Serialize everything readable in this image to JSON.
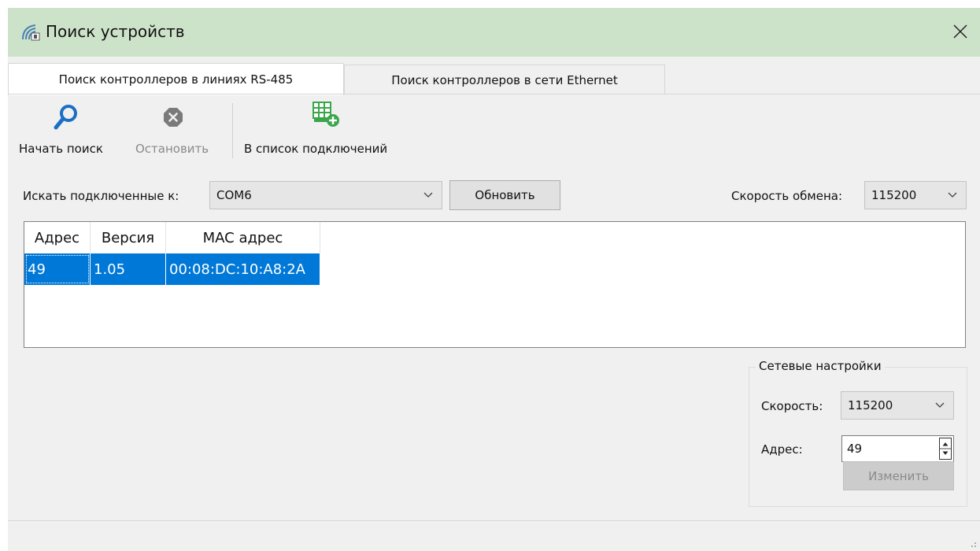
{
  "window": {
    "title": "Поиск устройств",
    "title_icon": "antenna-icon",
    "close_icon": "close-icon"
  },
  "tabs": [
    {
      "label": "Поиск контроллеров в линиях RS-485",
      "active": true
    },
    {
      "label": "Поиск контроллеров в сети Ethernet",
      "active": false
    }
  ],
  "toolbar": {
    "start": {
      "label": "Начать поиск",
      "icon": "search-icon",
      "color": "#1a6fc4"
    },
    "stop": {
      "label": "Остановить",
      "icon": "stop-icon",
      "disabled": true
    },
    "add": {
      "label": "В список подключений",
      "icon": "add-connection-icon",
      "color": "#3aa64a"
    }
  },
  "search": {
    "port_label": "Искать подключенные к:",
    "port_value": "COM6",
    "refresh_label": "Обновить",
    "speed_label": "Скорость обмена:",
    "speed_value": "115200"
  },
  "table": {
    "columns": [
      "Адрес",
      "Версия",
      "MAC адрес"
    ],
    "rows": [
      {
        "address": "49",
        "version": "1.05",
        "mac": "00:08:DC:10:A8:2A",
        "selected": true
      }
    ],
    "selection_color": "#0078d7"
  },
  "network": {
    "title": "Сетевые настройки",
    "speed_label": "Скорость:",
    "speed_value": "115200",
    "address_label": "Адрес:",
    "address_value": "49",
    "apply_label": "Изменить"
  },
  "colors": {
    "titlebar": "#cde3c9",
    "window_bg": "#f0f0f0",
    "accent": "#0078d7"
  }
}
